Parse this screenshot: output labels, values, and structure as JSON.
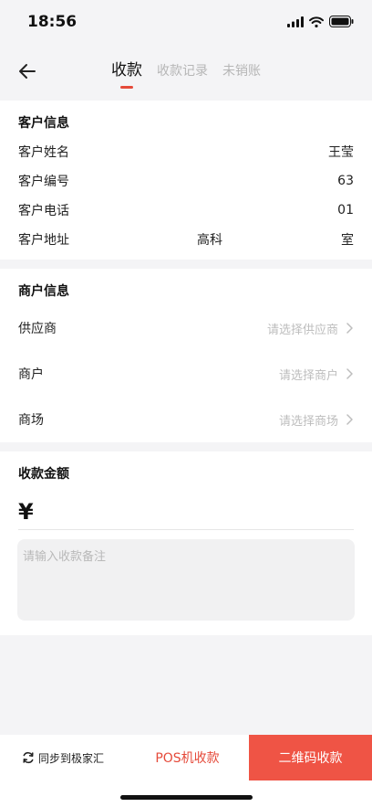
{
  "status_bar": {
    "time": "18:56"
  },
  "nav": {
    "tabs": [
      {
        "label": "收款",
        "active": true
      },
      {
        "label": "收款记录",
        "active": false
      },
      {
        "label": "未销账",
        "active": false
      }
    ]
  },
  "customer": {
    "title": "客户信息",
    "rows": [
      {
        "label": "客户姓名",
        "value": "王莹"
      },
      {
        "label": "客户编号",
        "value": "63"
      },
      {
        "label": "客户电话",
        "value": "01"
      },
      {
        "label": "客户地址",
        "middle": "高科",
        "value": "室"
      }
    ]
  },
  "merchant": {
    "title": "商户信息",
    "rows": [
      {
        "label": "供应商",
        "placeholder": "请选择供应商"
      },
      {
        "label": "商户",
        "placeholder": "请选择商户"
      },
      {
        "label": "商场",
        "placeholder": "请选择商场"
      }
    ]
  },
  "amount": {
    "title": "收款金额",
    "currency": "¥",
    "remark_placeholder": "请输入收款备注"
  },
  "bottom": {
    "sync_label": "同步到极家汇",
    "pos_label": "POS机收款",
    "qr_label": "二维码收款"
  },
  "colors": {
    "accent": "#e54a3a",
    "qr_button": "#ef5445"
  }
}
